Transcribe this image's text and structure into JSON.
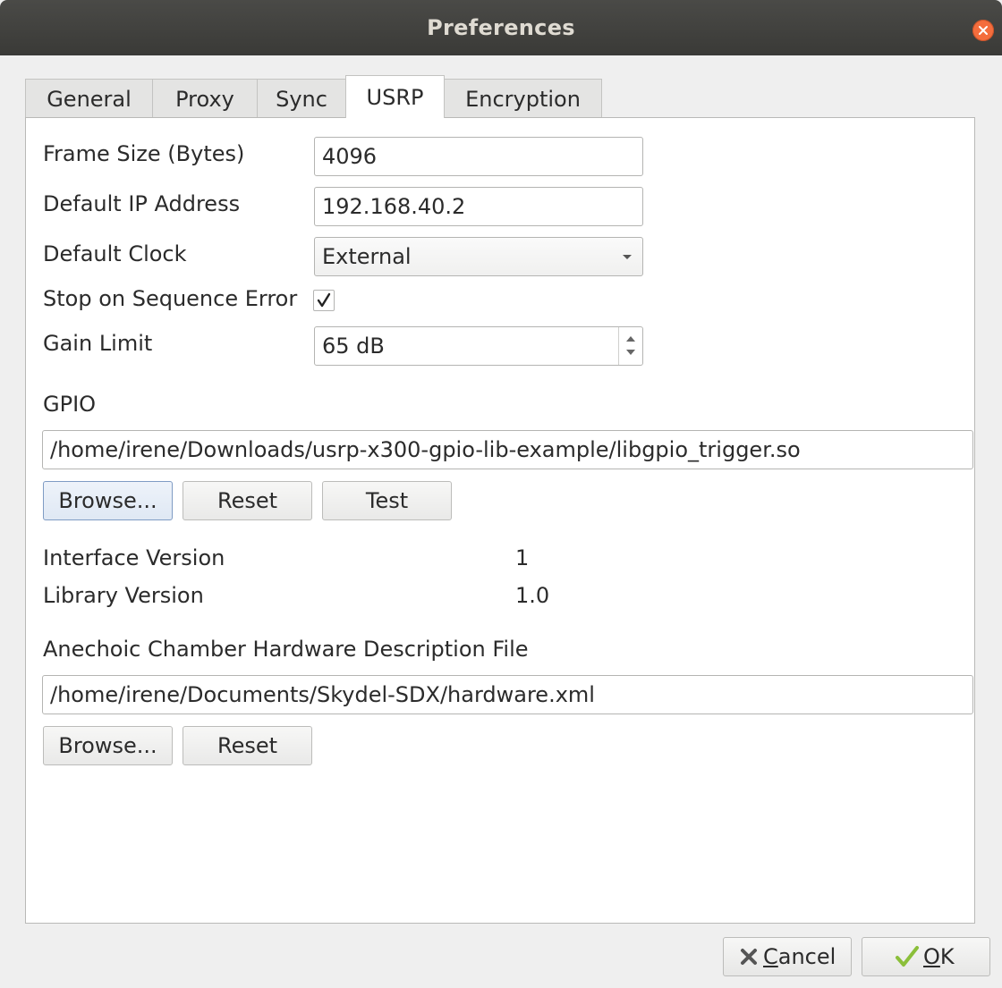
{
  "window": {
    "title": "Preferences"
  },
  "tabs": [
    {
      "label": "General",
      "active": false
    },
    {
      "label": "Proxy",
      "active": false
    },
    {
      "label": "Sync",
      "active": false
    },
    {
      "label": "USRP",
      "active": true
    },
    {
      "label": "Encryption",
      "active": false
    }
  ],
  "usrp": {
    "frame_size": {
      "label": "Frame Size (Bytes)",
      "value": "4096"
    },
    "default_ip": {
      "label": "Default IP Address",
      "value": "192.168.40.2"
    },
    "default_clock": {
      "label": "Default Clock",
      "value": "External"
    },
    "stop_on_sequence_error": {
      "label": "Stop on Sequence Error",
      "checked": true
    },
    "gain_limit": {
      "label": "Gain Limit",
      "value": "65 dB"
    }
  },
  "gpio": {
    "section_label": "GPIO",
    "path": "/home/irene/Downloads/usrp-x300-gpio-lib-example/libgpio_trigger.so",
    "browse_label": "Browse...",
    "reset_label": "Reset",
    "test_label": "Test",
    "interface_version_label": "Interface Version",
    "interface_version_value": "1",
    "library_version_label": "Library Version",
    "library_version_value": "1.0"
  },
  "anechoic": {
    "section_label": "Anechoic Chamber Hardware Description File",
    "path": "/home/irene/Documents/Skydel-SDX/hardware.xml",
    "browse_label": "Browse...",
    "reset_label": "Reset"
  },
  "footer": {
    "cancel_mnemonic": "C",
    "cancel_rest": "ancel",
    "ok_mnemonic": "O",
    "ok_rest": "K"
  },
  "colors": {
    "titlebar": "#3f3f3c",
    "close": "#f46d3d",
    "ok_check": "#8bbf3a",
    "focus_border": "#7f9cc4"
  },
  "icons": {
    "close": "close-icon",
    "checkbox_check": "check-icon",
    "cancel": "cancel-x-icon",
    "ok": "ok-check-icon",
    "combo": "chevron-down-icon",
    "spin": "spinner-arrows-icon"
  }
}
